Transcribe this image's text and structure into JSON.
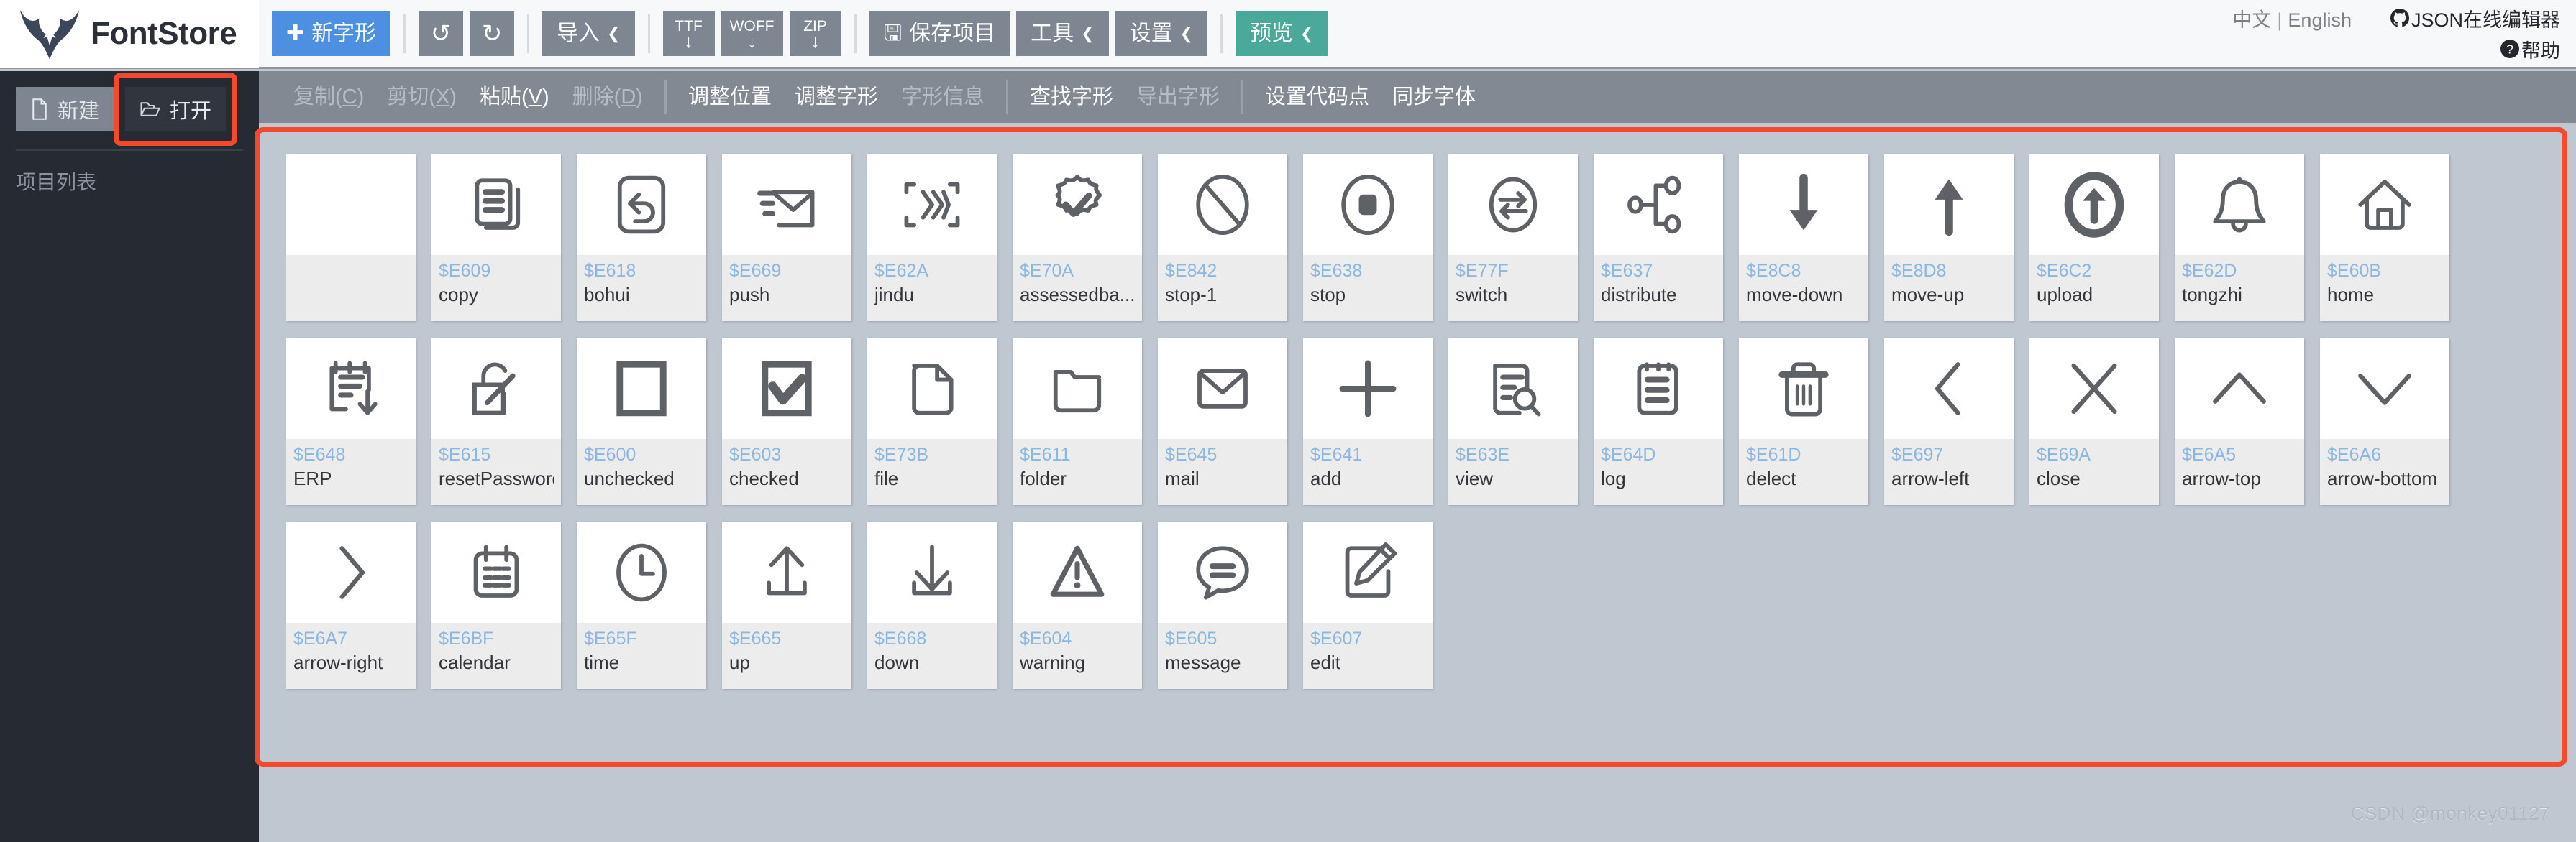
{
  "app": {
    "brand": "FontStore"
  },
  "toolbar": {
    "new_glyph": "新字形",
    "undo_icon": "undo-icon",
    "redo_icon": "redo-icon",
    "import": "导入",
    "export_ttf": "TTF",
    "export_woff": "WOFF",
    "export_zip": "ZIP",
    "save_project": "保存项目",
    "tools": "工具",
    "settings": "设置",
    "preview": "预览",
    "caret": "❯"
  },
  "topright": {
    "lang_zh": "中文",
    "lang_divider": "|",
    "lang_en": "English",
    "json_editor": "JSON在线编辑器",
    "help": "帮助"
  },
  "sidebar": {
    "new_button": "新建",
    "open_button": "打开",
    "project_list_label": "项目列表"
  },
  "menubar": {
    "groups": [
      [
        {
          "label": "复制(C)",
          "underline": "C",
          "disabled": true
        },
        {
          "label": "剪切(X)",
          "underline": "X",
          "disabled": true
        },
        {
          "label": "粘贴(V)",
          "underline": "V",
          "disabled": false
        },
        {
          "label": "删除(D)",
          "underline": "D",
          "disabled": true
        }
      ],
      [
        {
          "label": "调整位置",
          "disabled": false
        },
        {
          "label": "调整字形",
          "disabled": false
        },
        {
          "label": "字形信息",
          "disabled": true
        }
      ],
      [
        {
          "label": "查找字形",
          "disabled": false
        },
        {
          "label": "导出字形",
          "disabled": true
        }
      ],
      [
        {
          "label": "设置代码点",
          "disabled": false
        },
        {
          "label": "同步字体",
          "disabled": false
        }
      ]
    ]
  },
  "glyphs": [
    {
      "code": "",
      "name": "",
      "icon": "blank"
    },
    {
      "code": "$E609",
      "name": "copy",
      "icon": "copy"
    },
    {
      "code": "$E618",
      "name": "bohui",
      "icon": "bohui"
    },
    {
      "code": "$E669",
      "name": "push",
      "icon": "push"
    },
    {
      "code": "$E62A",
      "name": "jindu",
      "icon": "jindu"
    },
    {
      "code": "$E70A",
      "name": "assessedba...",
      "icon": "assessed"
    },
    {
      "code": "$E842",
      "name": "stop-1",
      "icon": "stop-1"
    },
    {
      "code": "$E638",
      "name": "stop",
      "icon": "stop"
    },
    {
      "code": "$E77F",
      "name": "switch",
      "icon": "switch"
    },
    {
      "code": "$E637",
      "name": "distribute",
      "icon": "distribute"
    },
    {
      "code": "$E8C8",
      "name": "move-down",
      "icon": "move-down"
    },
    {
      "code": "$E8D8",
      "name": "move-up",
      "icon": "move-up"
    },
    {
      "code": "$E6C2",
      "name": "upload",
      "icon": "upload"
    },
    {
      "code": "$E62D",
      "name": "tongzhi",
      "icon": "bell"
    },
    {
      "code": "$E60B",
      "name": "home",
      "icon": "home"
    },
    {
      "code": "$E648",
      "name": "ERP",
      "icon": "erp"
    },
    {
      "code": "$E615",
      "name": "resetPassword",
      "icon": "reset-password"
    },
    {
      "code": "$E600",
      "name": "unchecked",
      "icon": "unchecked"
    },
    {
      "code": "$E603",
      "name": "checked",
      "icon": "checked"
    },
    {
      "code": "$E73B",
      "name": "file",
      "icon": "file"
    },
    {
      "code": "$E611",
      "name": "folder",
      "icon": "folder"
    },
    {
      "code": "$E645",
      "name": "mail",
      "icon": "mail"
    },
    {
      "code": "$E641",
      "name": "add",
      "icon": "add"
    },
    {
      "code": "$E63E",
      "name": "view",
      "icon": "view"
    },
    {
      "code": "$E64D",
      "name": "log",
      "icon": "log"
    },
    {
      "code": "$E61D",
      "name": "delect",
      "icon": "trash"
    },
    {
      "code": "$E697",
      "name": "arrow-left",
      "icon": "chevron-left"
    },
    {
      "code": "$E69A",
      "name": "close",
      "icon": "close"
    },
    {
      "code": "$E6A5",
      "name": "arrow-top",
      "icon": "chevron-up"
    },
    {
      "code": "$E6A6",
      "name": "arrow-bottom",
      "icon": "chevron-down"
    },
    {
      "code": "$E6A7",
      "name": "arrow-right",
      "icon": "chevron-right"
    },
    {
      "code": "$E6BF",
      "name": "calendar",
      "icon": "calendar"
    },
    {
      "code": "$E65F",
      "name": "time",
      "icon": "clock"
    },
    {
      "code": "$E665",
      "name": "up",
      "icon": "upload-tray"
    },
    {
      "code": "$E668",
      "name": "down",
      "icon": "download-tray"
    },
    {
      "code": "$E604",
      "name": "warning",
      "icon": "warning"
    },
    {
      "code": "$E605",
      "name": "message",
      "icon": "message"
    },
    {
      "code": "$E607",
      "name": "edit",
      "icon": "edit"
    }
  ],
  "watermark": "CSDN @monkey01127",
  "colors": {
    "accent_blue": "#4d90e2",
    "accent_teal": "#4aa99a",
    "highlight_red": "#f4492d",
    "code_blue": "#8cb7e0",
    "sidebar_dark": "#262b33",
    "menubar_grey": "#828993",
    "canvas_grey": "#bfc7d0"
  }
}
